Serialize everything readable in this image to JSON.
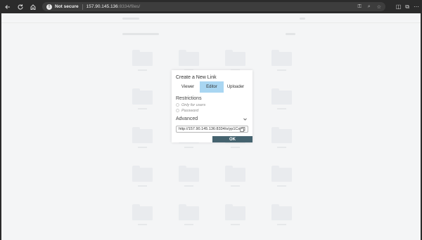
{
  "browser": {
    "security_label": "Not secure",
    "url_host": "157.90.145.136",
    "url_rest": ":8334/files/"
  },
  "dialog": {
    "title": "Create a New Link",
    "permissions": [
      {
        "label": "Viewer",
        "active": false
      },
      {
        "label": "Editor",
        "active": true
      },
      {
        "label": "Uploader",
        "active": false
      }
    ],
    "restrictions_title": "Restrictions",
    "only_for_users_label": "Only for users",
    "password_label": "Password",
    "advanced_label": "Advanced",
    "link_value": "http://157.90.145.136:8334/s/yp1CsbK",
    "ok_label": "OK"
  },
  "colors": {
    "accent_active": "#a9d6f2",
    "ok_button": "#45636f",
    "page_background": "#f4f5f6",
    "browser_chrome": "#2b2b2b"
  },
  "icons": [
    "back-arrow-icon",
    "reload-icon",
    "home-icon",
    "warning-icon",
    "key-icon",
    "zoom-icon",
    "star-icon",
    "sidebar-icon",
    "extensions-icon",
    "menu-icon",
    "chevron-down-icon",
    "copy-icon"
  ]
}
